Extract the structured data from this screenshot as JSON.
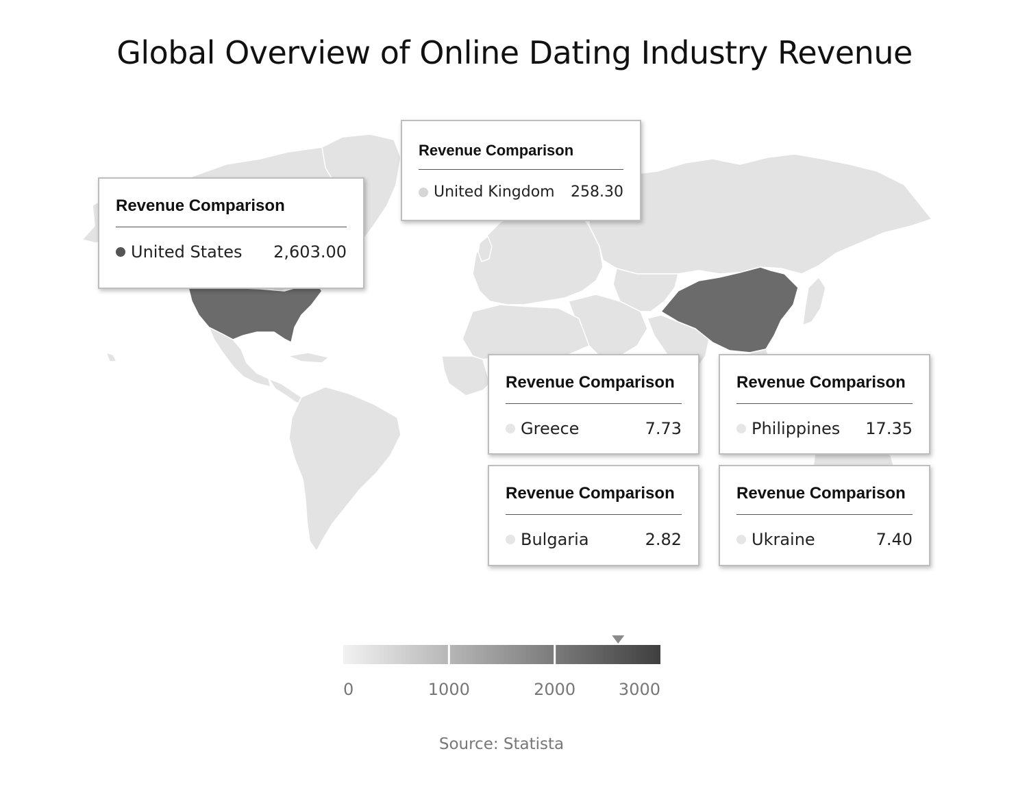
{
  "title": "Global Overview of Online Dating Industry Revenue",
  "source": "Source: Statista",
  "tooltip_title": "Revenue Comparison",
  "colors": {
    "background": "#ffffff",
    "land_default": "#e3e3e3",
    "land_border": "#ffffff",
    "high": "#6b6b6b",
    "tooltip_border": "#bdbdbd"
  },
  "tooltips": [
    {
      "country": "United States",
      "value": "2,603.00",
      "dot_color": "#555555"
    },
    {
      "country": "United Kingdom",
      "value": "258.30",
      "dot_color": "#d6d6d6"
    },
    {
      "country": "Greece",
      "value": "7.73",
      "dot_color": "#e6e6e6"
    },
    {
      "country": "Philippines",
      "value": "17.35",
      "dot_color": "#e6e6e6"
    },
    {
      "country": "Bulgaria",
      "value": "2.82",
      "dot_color": "#e6e6e6"
    },
    {
      "country": "Ukraine",
      "value": "7.40",
      "dot_color": "#e6e6e6"
    }
  ],
  "legend": {
    "min": 0,
    "max": 3000,
    "ticks": [
      "0",
      "1000",
      "2000",
      "3000"
    ],
    "pointer_value": 2600,
    "gradient_start": "#f2f2f2",
    "gradient_end": "#3f3f3f"
  }
}
